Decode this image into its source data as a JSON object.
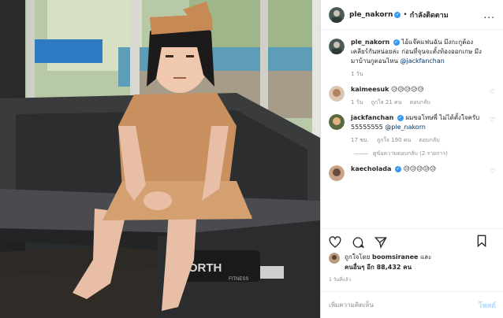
{
  "header": {
    "username": "ple_nakorn",
    "separator": "•",
    "follow_label": "กำลังติดตาม",
    "more_label": "..."
  },
  "caption": {
    "username": "ple_nakorn",
    "text": "ไอ้แจ๊คแฟนฉัน มึงกะกูต้องเคลียร์กันหน่อยล่ะ ก่อนที่จุนจะตั้งท้องออกเกษ มึงมาบ้านกูตอนไหน",
    "mention": "@jackfanchan",
    "time": "1 วัน"
  },
  "comments": [
    {
      "username": "kaimeesuk",
      "text": "😥😥😥😥😥",
      "time": "1 วัน",
      "likes": "ถูกใจ 21 คน",
      "reply_label": "ตอบกลับ"
    },
    {
      "username": "jackfanchan",
      "text": "ผมขอโทษพี่ ไม่ได้ตั้งใจครับ 55555555",
      "mention": "@ple_nakorn",
      "time": "17 ชม.",
      "likes": "ถูกใจ 190 คน",
      "reply_label": "ตอบกลับ",
      "view_replies": "ดูข้อความตอบกลับ (2 รายการ)"
    },
    {
      "username": "kaecholada",
      "text": "😥😥😥😥😥"
    }
  ],
  "likes": {
    "prefix": "ถูกใจโดย",
    "user": "boomsiranee",
    "and": "และ",
    "others": "คนอื่นๆ อีก 88,432 คน"
  },
  "post_time": "1 วันที่แล้ว",
  "add_comment": {
    "placeholder": "เพิ่มความคิดเห็น",
    "post_label": "โพสต์"
  },
  "photo": {
    "treadmill_brand": "NORTH",
    "treadmill_sub": "FITNESS"
  },
  "colors": {
    "verified": "#3897f0",
    "link": "#00376b",
    "post_disabled": "#b3dbff"
  }
}
